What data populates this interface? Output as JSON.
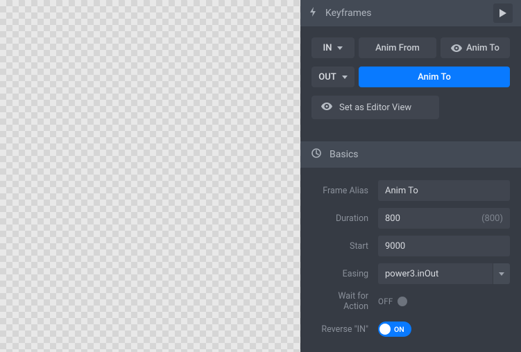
{
  "sections": {
    "keyframes": {
      "title": "Keyframes"
    },
    "basics": {
      "title": "Basics"
    }
  },
  "keyframes": {
    "in_label": "IN",
    "out_label": "OUT",
    "anim_from": "Anim From",
    "anim_to_in": "Anim To",
    "anim_to_out": "Anim To",
    "set_editor_view": "Set as Editor View"
  },
  "basics": {
    "frame_alias_label": "Frame Alias",
    "frame_alias_value": "Anim To",
    "duration_label": "Duration",
    "duration_value": "800",
    "duration_hint": "(800)",
    "start_label": "Start",
    "start_value": "9000",
    "easing_label": "Easing",
    "easing_value": "power3.inOut",
    "wait_label": "Wait for Action",
    "wait_value": "OFF",
    "reverse_label": "Reverse \"IN\"",
    "reverse_value": "ON"
  }
}
